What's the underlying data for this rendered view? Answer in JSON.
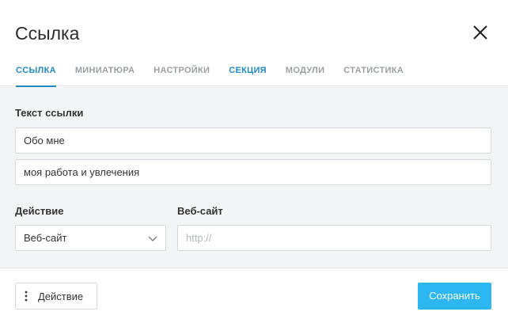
{
  "dialog": {
    "title": "Ссылка",
    "close_icon": "close-icon"
  },
  "tabs": [
    {
      "label": "ССЫЛКА",
      "active": true
    },
    {
      "label": "МИНИАТЮРА",
      "active": false
    },
    {
      "label": "НАСТРОЙКИ",
      "active": false
    },
    {
      "label": "СЕКЦИЯ",
      "active": false,
      "highlight": true
    },
    {
      "label": "МОДУЛИ",
      "active": false
    },
    {
      "label": "СТАТИСТИКА",
      "active": false
    }
  ],
  "form": {
    "link_text_label": "Текст ссылки",
    "link_text_value": "Обо мне",
    "link_subtext_value": "моя работа и увлечения",
    "action_label": "Действие",
    "action_selected": "Веб-сайт",
    "website_label": "Веб-сайт",
    "website_placeholder": "http://",
    "website_value": ""
  },
  "footer": {
    "action_button_label": "Действие",
    "save_button_label": "Сохранить"
  },
  "colors": {
    "accent": "#1e8bc3",
    "primary_button": "#2cb6f2",
    "body_background": "#f4f5f7"
  }
}
